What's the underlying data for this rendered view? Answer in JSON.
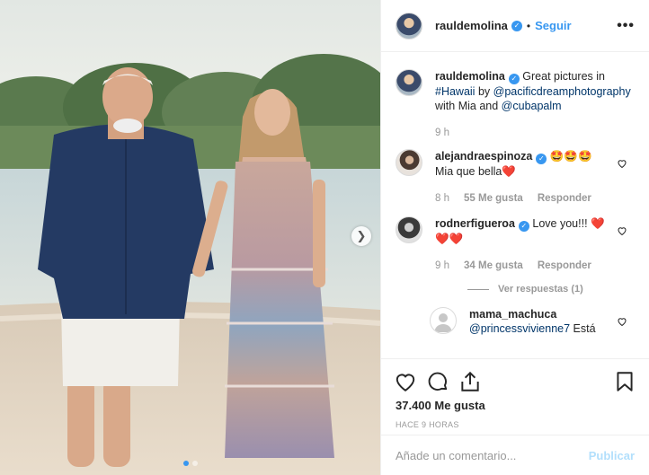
{
  "post": {
    "author": "rauldemolina",
    "follow_label": "Seguir",
    "dot": "•",
    "more_label": "•••"
  },
  "caption": {
    "username": "rauldemolina",
    "text_1": "Great pictures in",
    "hashtag": "#Hawaii",
    "text_2": "by",
    "mention_1": "@pacificdreamphotography",
    "text_3": "with Mia and",
    "mention_2": "@cubapalm",
    "time": "9 h"
  },
  "comments": [
    {
      "username": "alejandraespinoza",
      "text": "🤩🤩🤩",
      "text2": "Mia que bella❤️",
      "time": "8 h",
      "likes": "55 Me gusta",
      "reply_label": "Responder"
    },
    {
      "username": "rodnerfigueroa",
      "text": "Love you!!! ❤️",
      "text2": "❤️❤️",
      "time": "9 h",
      "likes": "34 Me gusta",
      "reply_label": "Responder",
      "view_replies": "Ver respuestas (1)"
    },
    {
      "username": "mama_machuca",
      "mention": "@princessvivienne7",
      "text": "Está"
    }
  ],
  "actions": {
    "likes_count": "37.400 Me gusta",
    "timestamp": "HACE 9 HORAS"
  },
  "compose": {
    "placeholder": "Añade un comentario...",
    "publish_label": "Publicar"
  },
  "colors": {
    "accent": "#3897f0",
    "link": "#003569",
    "muted": "#999999",
    "publish_disabled": "#b2dffc",
    "heart": "#ed4956"
  },
  "icons": {
    "like": "heart-outline-icon",
    "comment": "speech-bubble-icon",
    "share": "share-arrow-icon",
    "save": "bookmark-icon",
    "more": "ellipsis-icon",
    "next": "chevron-right-icon"
  },
  "carousel": {
    "slides": 2,
    "active": 1
  }
}
